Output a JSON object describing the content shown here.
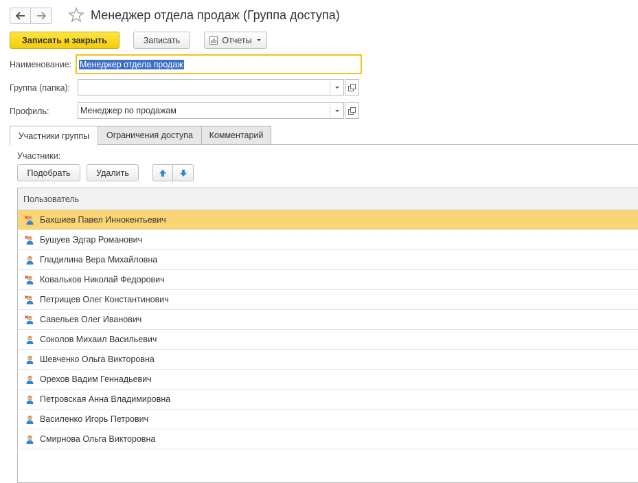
{
  "window": {
    "title": "Менеджер отдела продаж (Группа доступа)"
  },
  "toolbar": {
    "save_close_label": "Записать и закрыть",
    "save_label": "Записать",
    "reports_label": "Отчеты"
  },
  "form": {
    "name_label": "Наименование:",
    "name_value": "Менеджер отдела продаж",
    "group_label": "Группа (папка):",
    "group_value": "",
    "profile_label": "Профиль:",
    "profile_value": "Менеджер по продажам"
  },
  "tabs": [
    {
      "label": "Участники группы",
      "active": true
    },
    {
      "label": "Ограничения доступа",
      "active": false
    },
    {
      "label": "Комментарий",
      "active": false
    }
  ],
  "members": {
    "section_label": "Участники:",
    "pick_label": "Подобрать",
    "delete_label": "Удалить",
    "column_user": "Пользователь",
    "rows": [
      {
        "name": "Бахшиев Павел Иннокентьевич",
        "icon": "user-marked-icon",
        "selected": true
      },
      {
        "name": "Бушуев Эдгар Романович",
        "icon": "user-marked-icon",
        "selected": false
      },
      {
        "name": "Гладилина Вера Михайловна",
        "icon": "user-icon",
        "selected": false
      },
      {
        "name": "Ковальков Николай Федорович",
        "icon": "user-marked-icon",
        "selected": false
      },
      {
        "name": "Петрищев Олег Константинович",
        "icon": "user-marked-icon",
        "selected": false
      },
      {
        "name": "Савельев Олег Иванович",
        "icon": "user-marked-icon",
        "selected": false
      },
      {
        "name": "Соколов Михаил Васильевич",
        "icon": "user-icon",
        "selected": false
      },
      {
        "name": "Шевченко Ольга Викторовна",
        "icon": "user-icon",
        "selected": false
      },
      {
        "name": "Орехов Вадим Геннадьевич",
        "icon": "user-icon",
        "selected": false
      },
      {
        "name": "Петровская Анна Владимировна",
        "icon": "user-icon",
        "selected": false
      },
      {
        "name": "Василенко Игорь Петрович",
        "icon": "user-icon",
        "selected": false
      },
      {
        "name": "Смирнова Ольга Викторовна",
        "icon": "user-icon",
        "selected": false
      }
    ]
  },
  "colors": {
    "primary_button": "#f5cd08",
    "selected_row": "#fad575",
    "focus_border": "#f0c419",
    "text_selection": "#3d6fc7",
    "arrow_blue": "#2f86d6"
  }
}
